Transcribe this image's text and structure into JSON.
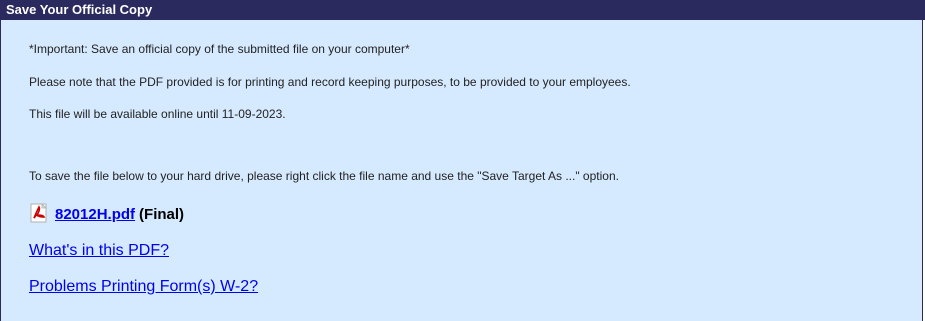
{
  "panel": {
    "title": "Save Your Official Copy",
    "important_note": "*Important: Save an official copy of the submitted file on your computer*",
    "pdf_note": "Please note that the PDF provided is for printing and record keeping purposes, to be provided to your employees.",
    "availability_note": "This file will be available online until 11-09-2023.",
    "save_instructions": "To save the file below to your hard drive, please right click the file name and use the \"Save Target As ...\" option.",
    "file": {
      "icon": "pdf-icon",
      "name": "82012H.pdf",
      "status": "(Final)"
    },
    "links": {
      "whats_in_pdf": "What's in this PDF?",
      "printing_problems": "Problems Printing Form(s) W-2?"
    }
  },
  "colors": {
    "header_bg": "#2b2a5e",
    "body_bg": "#d6eaff",
    "link": "#0000ee"
  }
}
